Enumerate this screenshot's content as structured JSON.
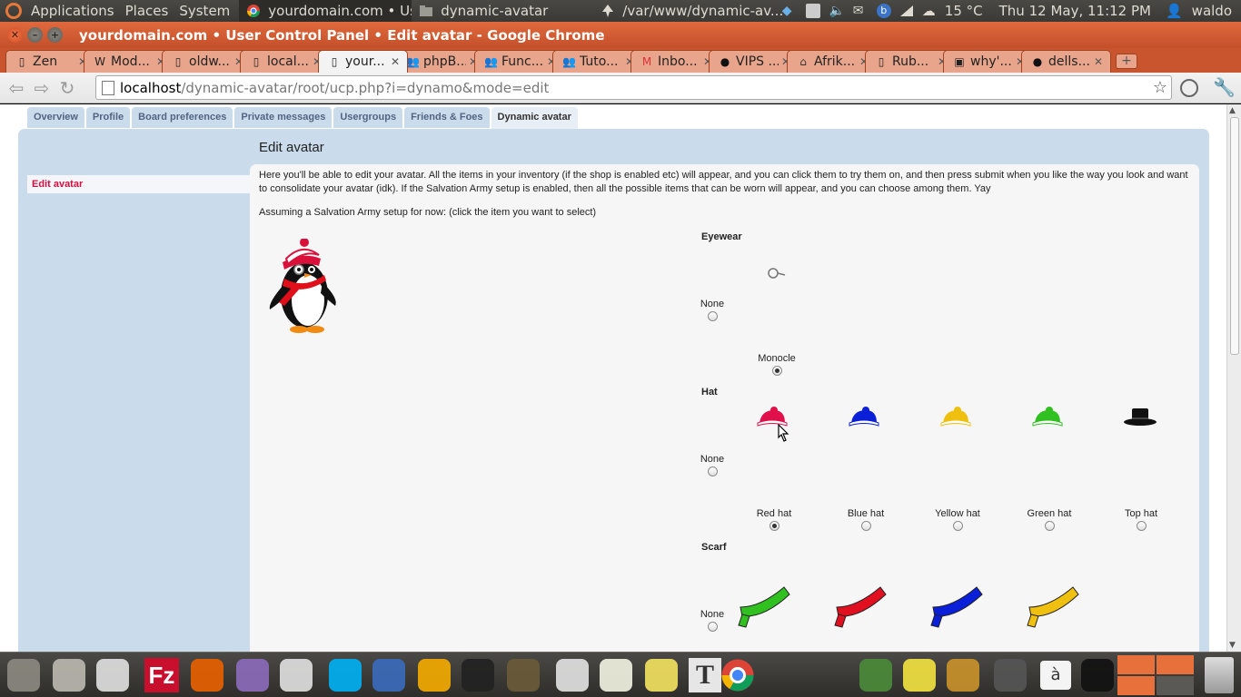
{
  "top_panel": {
    "menus": [
      "Applications",
      "Places",
      "System"
    ],
    "tasks": [
      {
        "label": "yourdomain.com • Us...",
        "active": true
      },
      {
        "label": "dynamic-avatar",
        "active": false
      },
      {
        "label": "/var/www/dynamic-av...",
        "active": false
      }
    ],
    "weather": "15 °C",
    "clock": "Thu 12 May, 11:12 PM",
    "user": "waldo"
  },
  "window": {
    "title": "yourdomain.com • User Control Panel • Edit avatar - Google Chrome"
  },
  "browser_tabs": [
    {
      "label": "Zen",
      "icon": "page-icon"
    },
    {
      "label": "Mod...",
      "icon": "wikipedia-icon"
    },
    {
      "label": "oldw...",
      "icon": "page-icon"
    },
    {
      "label": "local...",
      "icon": "page-icon"
    },
    {
      "label": "your...",
      "icon": "page-icon",
      "active": true
    },
    {
      "label": "phpB...",
      "icon": "phpbb-icon"
    },
    {
      "label": "Func...",
      "icon": "phpbb-icon"
    },
    {
      "label": "Tuto...",
      "icon": "phpbb-icon"
    },
    {
      "label": "Inbo...",
      "icon": "gmail-icon"
    },
    {
      "label": "VIPS ...",
      "icon": "github-icon"
    },
    {
      "label": "Afrik...",
      "icon": "house-icon"
    },
    {
      "label": "Rub...",
      "icon": "page-icon"
    },
    {
      "label": "why'...",
      "icon": "image-icon"
    },
    {
      "label": "dells...",
      "icon": "github-icon"
    }
  ],
  "address_bar": {
    "host": "localhost",
    "path": "/dynamic-avatar/root/ucp.php?i=dynamo&mode=edit"
  },
  "ucp": {
    "nav_tabs": [
      "Overview",
      "Profile",
      "Board preferences",
      "Private messages",
      "Usergroups",
      "Friends & Foes",
      "Dynamic avatar"
    ],
    "active_tab": "Dynamic avatar",
    "side_link": "Edit avatar",
    "page_title": "Edit avatar",
    "intro": "Here you'll be able to edit your avatar. All the items in your inventory (if the shop is enabled etc) will appear, and you can click them to try them on, and then press submit when you like the way you look and want to consolidate your avatar (idk). If the Salvation Army setup is enabled, then all the possible items that can be worn will appear, and you can choose among them. Yay",
    "assume": "Assuming a Salvation Army setup for now: (click the item you want to select)",
    "categories": {
      "eyewear": {
        "title": "Eyewear",
        "none_label": "None",
        "options": [
          {
            "label": "Monocle",
            "selected": true,
            "color": "#777777"
          }
        ]
      },
      "hat": {
        "title": "Hat",
        "none_label": "None",
        "options": [
          {
            "label": "Red hat",
            "selected": true,
            "color": "#e0104a"
          },
          {
            "label": "Blue hat",
            "selected": false,
            "color": "#0a1fd8"
          },
          {
            "label": "Yellow hat",
            "selected": false,
            "color": "#f0c010"
          },
          {
            "label": "Green hat",
            "selected": false,
            "color": "#30c020"
          },
          {
            "label": "Top hat",
            "selected": false,
            "color": "#111111"
          }
        ]
      },
      "scarf": {
        "title": "Scarf",
        "none_label": "None",
        "options": [
          {
            "color": "#30c020"
          },
          {
            "color": "#e01020"
          },
          {
            "color": "#0a1fd8"
          },
          {
            "color": "#f0c010"
          }
        ]
      }
    }
  },
  "dock_apps": [
    "files",
    "settings",
    "phone",
    "filezilla",
    "firefox",
    "pidgin",
    "empathy",
    "skype",
    "bluefish",
    "audacity",
    "inkscape",
    "gimp",
    "paint",
    "gedit",
    "tomboy",
    "typography",
    "chrome",
    "colorpicker",
    "notes",
    "search",
    "calculator",
    "charmap",
    "sysmon"
  ]
}
